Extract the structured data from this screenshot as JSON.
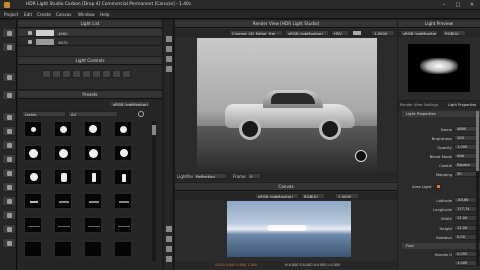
{
  "window": {
    "title": "HDR Light Studio Carbon [Drop 4] Commercial Permanent [Carucie] - 1.40c",
    "min": "–",
    "max": "□",
    "close": "✕"
  },
  "menu": [
    "Project",
    "Edit",
    "Create",
    "Canvas",
    "Window",
    "Help"
  ],
  "light_list": {
    "title": "Light List",
    "items": [
      {
        "value": "4660"
      },
      {
        "value": "4670"
      }
    ]
  },
  "light_controls": {
    "title": "Light Controls"
  },
  "presets": {
    "title": "Presets",
    "color_space": "sRGB (rgbMonitor)",
    "filter1": "Lights",
    "filter2": "All"
  },
  "render_view": {
    "title": "Render View [HDR Light Studio]",
    "camera": "Cinema_4D_Editor_frm",
    "color_space": "sRGB (rgbMonitor)",
    "mode": "HSV",
    "exposure": "1.0000",
    "light_paint_label": "LightPaint:",
    "light_paint_value": "Reflection",
    "frame_label": "Frame:",
    "frame_value": "0"
  },
  "canvas": {
    "title": "Canvas",
    "color_space": "sRGB (rgbMonitor)",
    "channel": "RGB(A)",
    "exposure": "1.0000",
    "status_left": "0.000 0.000 0.000 1.000",
    "status_right": "H:0.000 S:0.000 V:0.000 L:0.000"
  },
  "light_preview": {
    "title": "Light Preview",
    "color_space": "sRGB (rgbMonitor)",
    "channel": "RGB(A)"
  },
  "right_tabs": {
    "tab1": "Render View Settings",
    "tab2": "Light Properties"
  },
  "light_properties": {
    "section": "Light Properties",
    "rows": [
      {
        "label": "Name",
        "value": "4660"
      },
      {
        "label": "Brightness",
        "value": "100"
      },
      {
        "label": "Opacity",
        "value": "1.000"
      },
      {
        "label": "Blend Mode",
        "value": "Add"
      },
      {
        "label": "Cookie",
        "value": "Square"
      },
      {
        "label": "Mapping",
        "value": "30"
      }
    ],
    "area_light_label": "Area Light",
    "area_light_checked": true,
    "pos_rows": [
      {
        "label": "Latitude",
        "value": "-63,66"
      },
      {
        "label": "Longitude",
        "value": "177,74"
      },
      {
        "label": "Width",
        "value": "12,00"
      },
      {
        "label": "Height",
        "value": "12,00"
      },
      {
        "label": "Rotation",
        "value": "0,00"
      }
    ],
    "footer_section": "Fuel",
    "handle_label": "Handle U",
    "handle_value": "0,092",
    "last_value": "1,000"
  },
  "colors": {
    "bg": "#1e1e1e",
    "panel": "#2b2b2b",
    "header": "#333333",
    "accent_orange": "#e07a2a",
    "status_red": "#c24b4b",
    "status_green": "#3fae4a",
    "status_blue": "#4a7bd6"
  }
}
